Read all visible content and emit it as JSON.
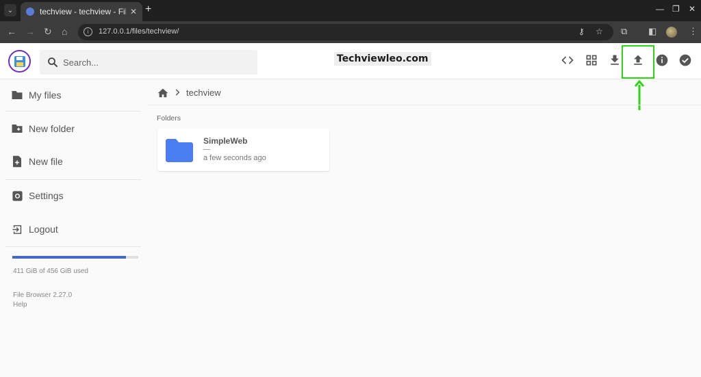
{
  "browser": {
    "tab_title": "techview - techview - File Browser",
    "url": "127.0.0.1/files/techview/"
  },
  "header": {
    "search_placeholder": "Search...",
    "watermark": "Techviewleo.com"
  },
  "sidebar": {
    "items": [
      {
        "label": "My files",
        "icon": "folder-icon"
      },
      {
        "label": "New folder",
        "icon": "create-folder-icon"
      },
      {
        "label": "New file",
        "icon": "note-add-icon"
      },
      {
        "label": "Settings",
        "icon": "settings-icon"
      },
      {
        "label": "Logout",
        "icon": "exit-icon"
      }
    ],
    "usage_text": "411 GiB of 456 GiB used",
    "usage_fraction": 0.9,
    "version": "File Browser 2.27.0",
    "help": "Help"
  },
  "main": {
    "breadcrumb": "techview",
    "section": "Folders",
    "folders": [
      {
        "name": "SimpleWeb",
        "size": "—",
        "modified": "a few seconds ago"
      }
    ]
  },
  "colors": {
    "accent": "#4267c7",
    "folder": "#4a7ef0",
    "highlight": "#2bd614"
  }
}
